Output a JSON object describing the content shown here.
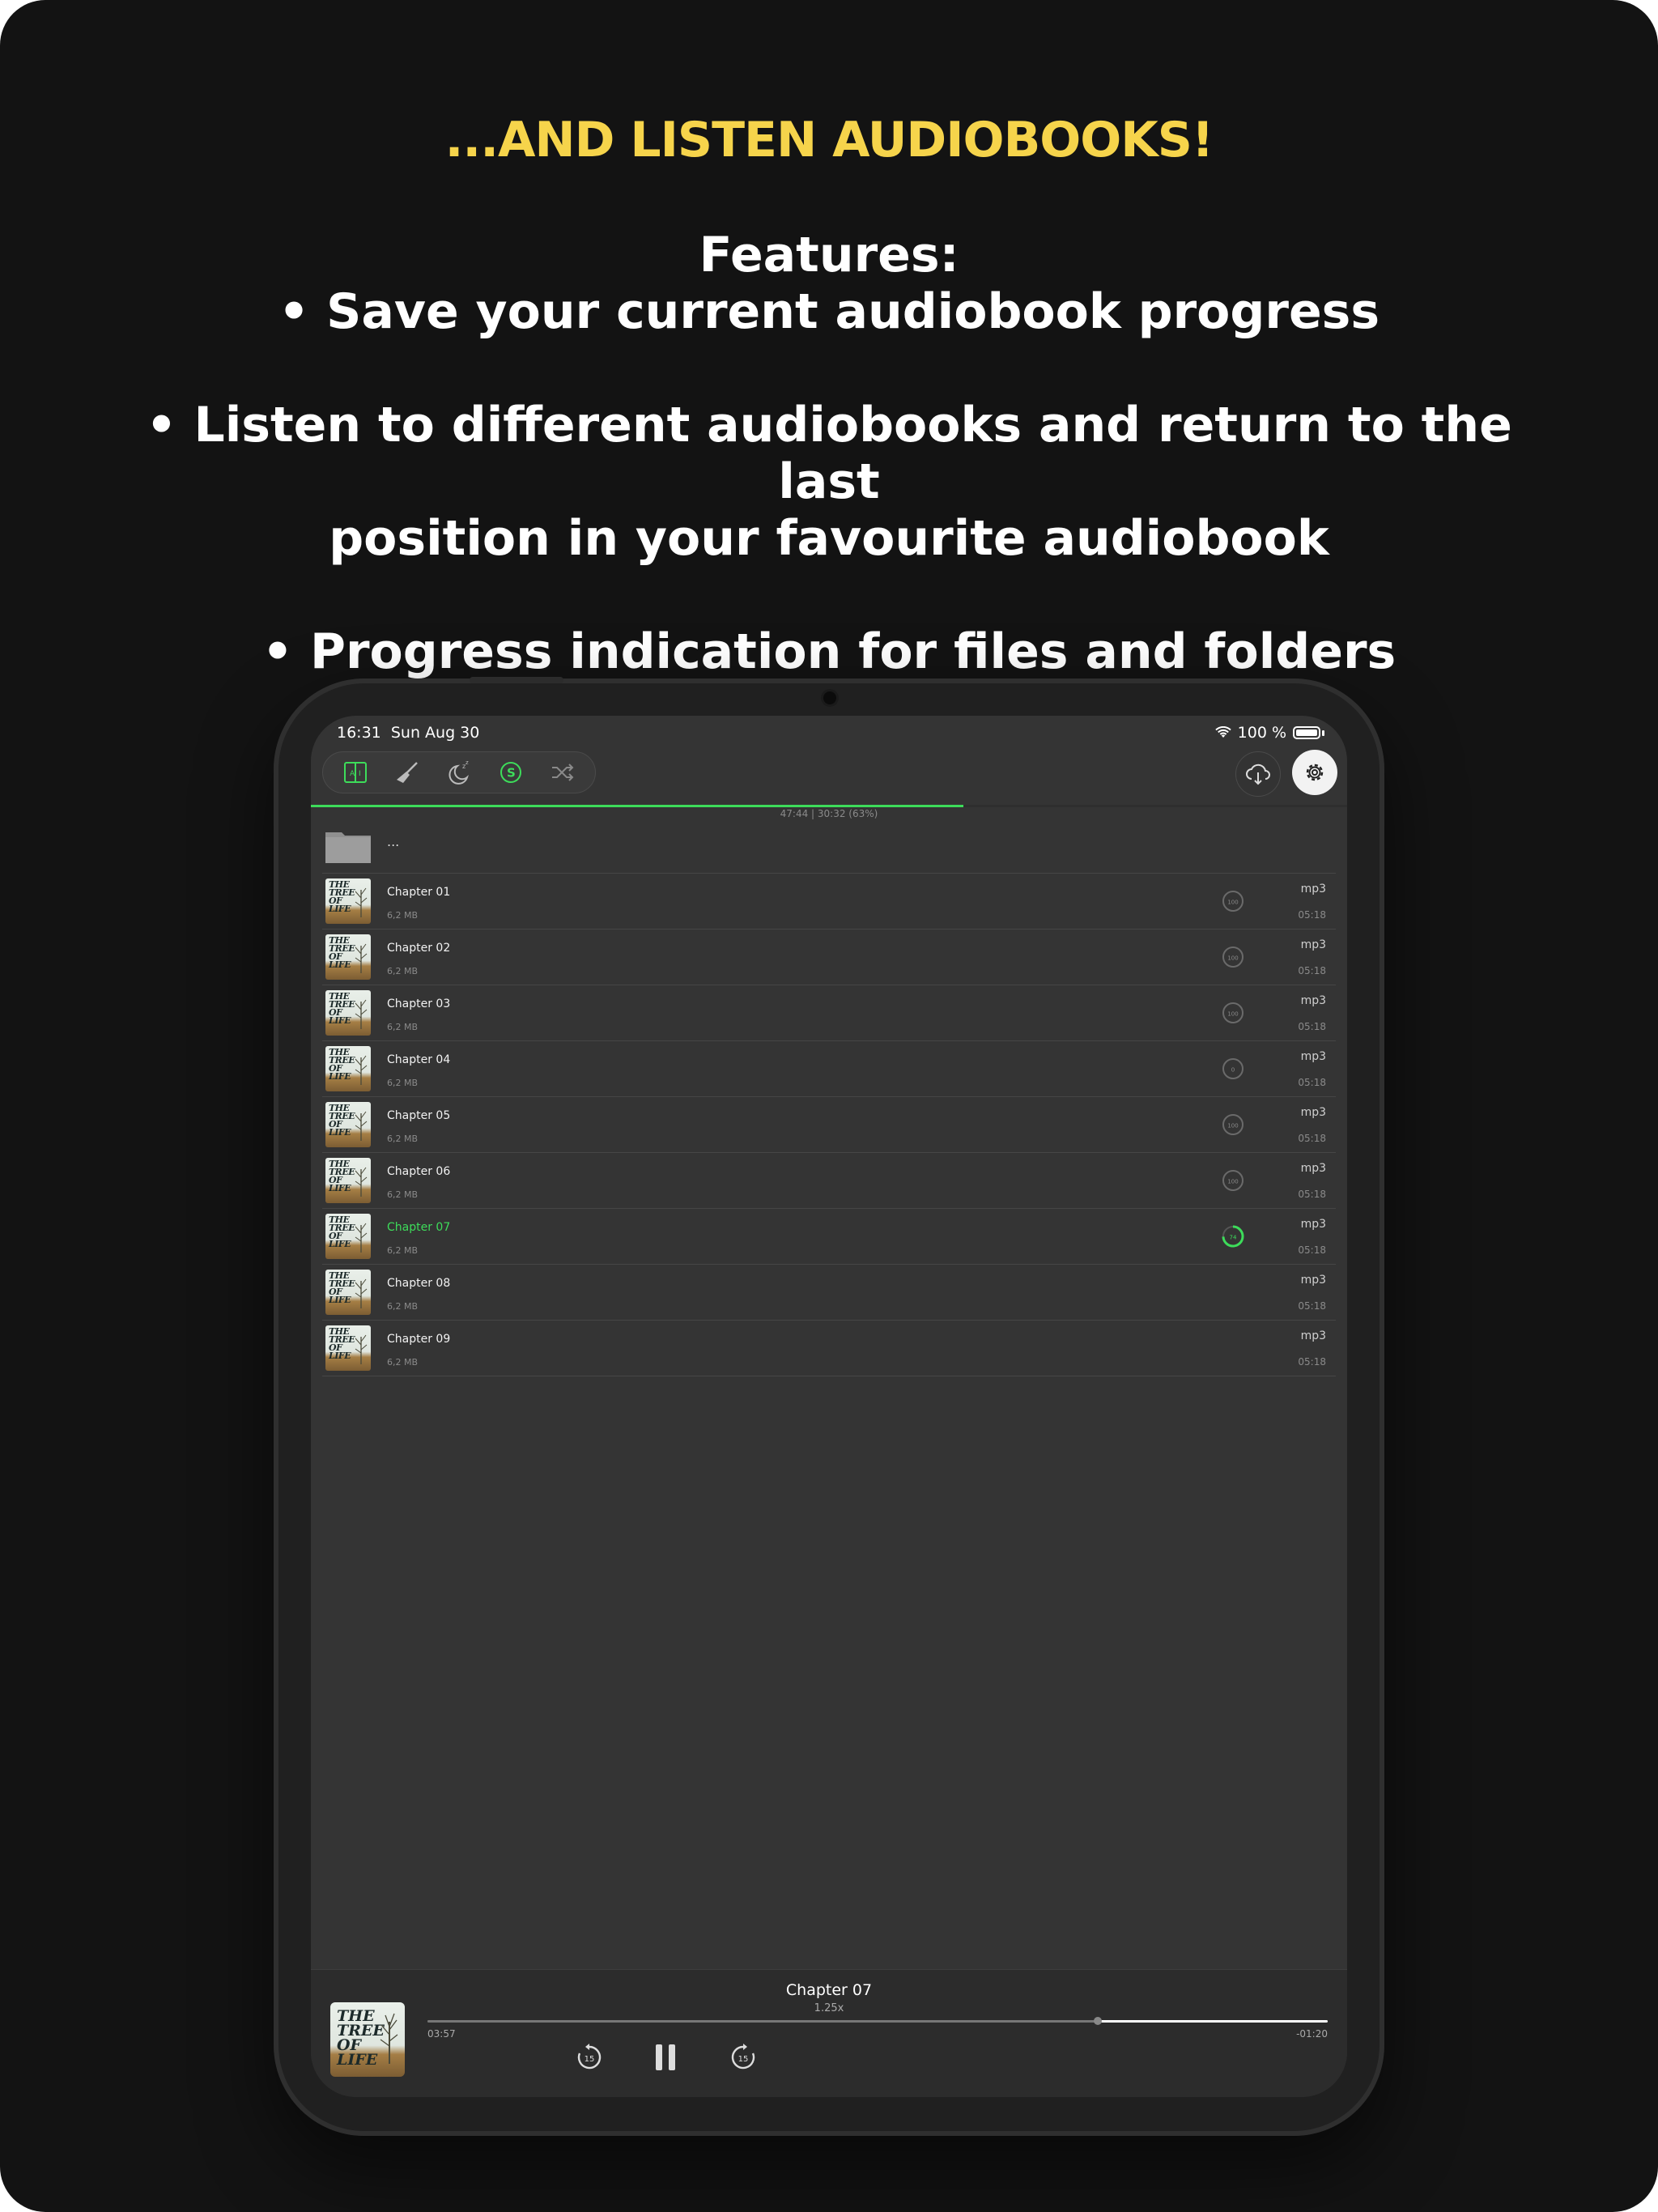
{
  "headline": "...AND LISTEN AUDIOBOOKS!",
  "features": {
    "heading": "Features:",
    "item1": "• Save your current audiobook progress",
    "item2_line1": "• Listen to different audiobooks and return to the last",
    "item2_line2": "position in your favourite audiobook",
    "item3": "• Progress indication for files and folders"
  },
  "status_bar": {
    "time": "16:31",
    "date": "Sun Aug 30",
    "battery": "100 %"
  },
  "toolbar": {
    "icons": [
      "book-icon",
      "broom-icon",
      "sleep-timer-icon",
      "dollar-circle-icon",
      "shuffle-icon"
    ],
    "right_icons": [
      "cloud-download-icon",
      "gear-icon"
    ]
  },
  "overall_progress": {
    "text": "47:44  |  30:32  (63%)",
    "fraction": 0.63,
    "color": "#3ddc5a"
  },
  "folder_up": {
    "label": "..."
  },
  "files": [
    {
      "title": "Chapter 01",
      "size": "6,2 MB",
      "ext": "mp3",
      "duration": "05:18",
      "progress": "100",
      "progress_value": 100,
      "active": false
    },
    {
      "title": "Chapter 02",
      "size": "6,2 MB",
      "ext": "mp3",
      "duration": "05:18",
      "progress": "100",
      "progress_value": 100,
      "active": false
    },
    {
      "title": "Chapter 03",
      "size": "6,2 MB",
      "ext": "mp3",
      "duration": "05:18",
      "progress": "100",
      "progress_value": 100,
      "active": false
    },
    {
      "title": "Chapter 04",
      "size": "6,2 MB",
      "ext": "mp3",
      "duration": "05:18",
      "progress": "0",
      "progress_value": 0,
      "active": false
    },
    {
      "title": "Chapter 05",
      "size": "6,2 MB",
      "ext": "mp3",
      "duration": "05:18",
      "progress": "100",
      "progress_value": 100,
      "active": false
    },
    {
      "title": "Chapter 06",
      "size": "6,2 MB",
      "ext": "mp3",
      "duration": "05:18",
      "progress": "100",
      "progress_value": 100,
      "active": false
    },
    {
      "title": "Chapter 07",
      "size": "6,2 MB",
      "ext": "mp3",
      "duration": "05:18",
      "progress": "74",
      "progress_value": 74,
      "active": true
    },
    {
      "title": "Chapter 08",
      "size": "6,2 MB",
      "ext": "mp3",
      "duration": "05:18",
      "progress": "",
      "progress_value": null,
      "active": false
    },
    {
      "title": "Chapter 09",
      "size": "6,2 MB",
      "ext": "mp3",
      "duration": "05:18",
      "progress": "",
      "progress_value": null,
      "active": false
    }
  ],
  "cover_text": [
    "THE",
    "TREE",
    "OF",
    "LIFE"
  ],
  "player": {
    "title": "Chapter 07",
    "speed": "1.25x",
    "elapsed": "03:57",
    "remaining": "-01:20",
    "position_fraction": 0.745,
    "skip_back": "15",
    "skip_forward": "15"
  },
  "colors": {
    "accent": "#3ddc5a",
    "headline": "#f6d44b",
    "background": "#131313"
  }
}
